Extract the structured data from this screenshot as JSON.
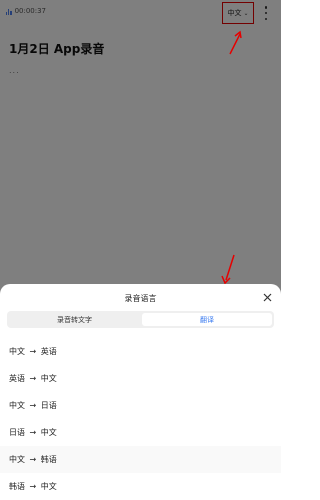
{
  "topbar": {
    "time": "00:00:37",
    "lang_label": "中文",
    "chevron": "⌄"
  },
  "note": {
    "title": "1月2日 App录音",
    "placeholder": "..."
  },
  "sheet": {
    "title": "录音语言",
    "tabs": [
      {
        "label": "录音转文字",
        "active": false
      },
      {
        "label": "翻译",
        "active": true
      }
    ],
    "options": [
      "中文 → 英语",
      "英语 → 中文",
      "中文 → 日语",
      "日语 → 中文",
      "中文 → 韩语",
      "韩语 → 中文"
    ]
  },
  "colors": {
    "accent": "#3a7bf0",
    "annotation": "#e60000"
  },
  "icons": [
    "waveform-icon",
    "chevron-down-icon",
    "more-vertical-icon",
    "close-icon",
    "annotation-arrow-icon"
  ]
}
